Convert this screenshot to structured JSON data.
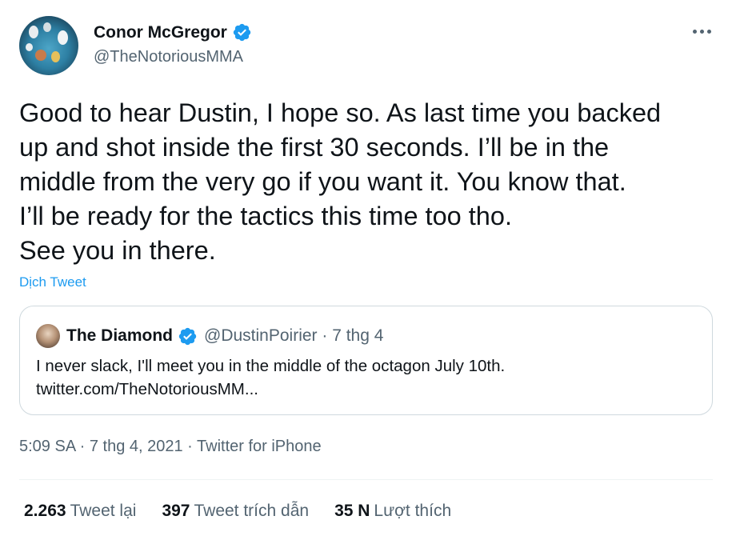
{
  "author": {
    "name": "Conor McGregor",
    "handle": "@TheNotoriousMMA"
  },
  "tweet": {
    "text": "Good to hear Dustin, I hope so. As last time you backed\nup and shot inside the first 30 seconds. I’ll be in the\nmiddle from the very go if you want it. You know that.\nI’ll be ready for the tactics this time too tho.\nSee you in there.",
    "translate_label": "Dịch Tweet"
  },
  "quote": {
    "name": "The Diamond",
    "handle_date": "@DustinPoirier · 7 thg 4",
    "text": "I never slack, I'll meet you in the middle of the octagon July 10th.\ntwitter.com/TheNotoriousMM..."
  },
  "meta": {
    "time_date": "5:09 SA · 7 thg 4, 2021 · ",
    "source": "Twitter for iPhone"
  },
  "stats": {
    "retweets_count": "2.263",
    "retweets_label": "Tweet lại",
    "quotes_count": "397",
    "quotes_label": "Tweet trích dẫn",
    "likes_count": "35 N",
    "likes_label": "Lượt thích"
  },
  "colors": {
    "link_blue": "#1d9bf0",
    "secondary_text": "#536471",
    "primary_text": "#0f1419",
    "border": "#cfd9de"
  },
  "icons": [
    "verified-badge-icon",
    "more-options-icon"
  ]
}
